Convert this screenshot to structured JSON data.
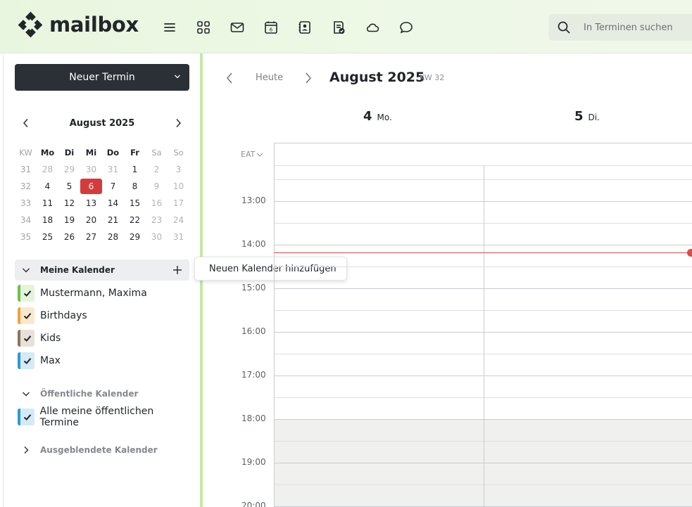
{
  "app": {
    "logo_text": "mailbox",
    "search_placeholder": "In Terminen suchen",
    "nav_icons": [
      "menu-icon",
      "apps-grid-icon",
      "mail-icon",
      "calendar-icon",
      "contacts-icon",
      "tasks-icon",
      "cloud-icon",
      "chat-icon"
    ],
    "calendar_icon_day": "6"
  },
  "sidebar": {
    "new_button_label": "Neuer Termin",
    "mini_calendar": {
      "title": "August 2025",
      "headers": [
        "KW",
        "Mo",
        "Di",
        "Mi",
        "Do",
        "Fr",
        "Sa",
        "So"
      ],
      "rows": [
        [
          "31",
          "28",
          "29",
          "30",
          "31",
          "1",
          "2",
          "3"
        ],
        [
          "32",
          "4",
          "5",
          "6",
          "7",
          "8",
          "9",
          "10"
        ],
        [
          "33",
          "11",
          "12",
          "13",
          "14",
          "15",
          "16",
          "17"
        ],
        [
          "34",
          "18",
          "19",
          "20",
          "21",
          "22",
          "23",
          "24"
        ],
        [
          "35",
          "25",
          "26",
          "27",
          "28",
          "29",
          "30",
          "31"
        ]
      ],
      "today": "6"
    },
    "my_calendars_label": "Meine Kalender",
    "add_calendar_tooltip": "Neuen Kalender hinzufügen",
    "my_calendars": [
      {
        "name": "Mustermann, Maxima",
        "color": "#6cc24a",
        "bg": "#e4f4da"
      },
      {
        "name": "Birthdays",
        "color": "#f0a23c",
        "bg": "#fbe8cc"
      },
      {
        "name": "Kids",
        "color": "#8a7560",
        "bg": "#e8e1d8"
      },
      {
        "name": "Max",
        "color": "#2c9ad6",
        "bg": "#d3eaf7"
      }
    ],
    "public_calendars_label": "Öffentliche Kalender",
    "public_calendars": [
      {
        "name": "Alle meine öffentlichen Termine",
        "color": "#2c9ad6",
        "bg": "#d3eaf7"
      }
    ],
    "hidden_calendars_label": "Ausgeblendete Kalender"
  },
  "main": {
    "today_label": "Heute",
    "title": "August 2025",
    "week_label": "KW 32",
    "days": [
      {
        "num": "4",
        "weekday": "Mo."
      },
      {
        "num": "5",
        "weekday": "Di."
      }
    ],
    "timezone": "EAT",
    "times": [
      "13:00",
      "14:00",
      "15:00",
      "16:00",
      "17:00",
      "18:00",
      "19:00",
      "20:00"
    ]
  }
}
